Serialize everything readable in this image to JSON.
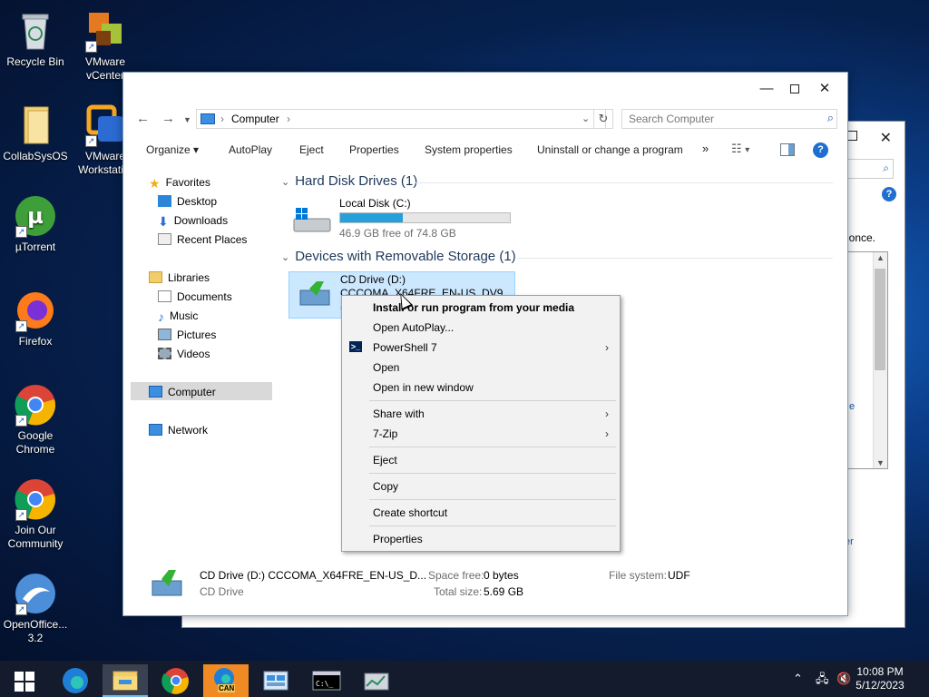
{
  "desktop": {
    "icons": [
      {
        "label": "Recycle Bin"
      },
      {
        "label": "VMware vCenter"
      },
      {
        "label": "CollabSysOS"
      },
      {
        "label": "VMware Workstati..."
      },
      {
        "label": "µTorrent"
      },
      {
        "label": "Firefox"
      },
      {
        "label": "Google Chrome"
      },
      {
        "label": "Join Our Community"
      },
      {
        "label": "OpenOffice... 3.2"
      }
    ]
  },
  "background_window": {
    "text": "once.",
    "link1": "e",
    "link2": "er"
  },
  "explorer": {
    "breadcrumb": "Computer",
    "search_placeholder": "Search Computer",
    "toolbar": {
      "organize": "Organize",
      "autoplay": "AutoPlay",
      "eject": "Eject",
      "properties": "Properties",
      "system_properties": "System properties",
      "uninstall": "Uninstall or change a program",
      "more": "»"
    },
    "nav": {
      "favorites": "Favorites",
      "desktop": "Desktop",
      "downloads": "Downloads",
      "recent_places": "Recent Places",
      "libraries": "Libraries",
      "documents": "Documents",
      "music": "Music",
      "pictures": "Pictures",
      "videos": "Videos",
      "computer": "Computer",
      "network": "Network"
    },
    "groups": {
      "hdd": "Hard Disk Drives (1)",
      "removable": "Devices with Removable Storage (1)"
    },
    "local_disk": {
      "name": "Local Disk (C:)",
      "free": "46.9 GB free of 74.8 GB",
      "used_fraction": 0.37
    },
    "cd_drive": {
      "name": "CD Drive (D:)",
      "label": "CCCOMA_X64FRE_EN-US_DV9",
      "extra": "("
    },
    "details": {
      "title": "CD Drive (D:) CCCOMA_X64FRE_EN-US_D...",
      "type": "CD Drive",
      "space_free_label": "Space free:",
      "space_free": "0 bytes",
      "total_size_label": "Total size:",
      "total_size": "5.69 GB",
      "fs_label": "File system:",
      "fs": "UDF"
    }
  },
  "context_menu": {
    "items": [
      {
        "label": "Install or run program from your media",
        "bold": true
      },
      {
        "label": "Open AutoPlay..."
      },
      {
        "label": "PowerShell 7",
        "submenu": true
      },
      {
        "label": "Open"
      },
      {
        "label": "Open in new window"
      },
      {
        "label": "Share with",
        "submenu": true
      },
      {
        "label": "7-Zip",
        "submenu": true
      },
      {
        "label": "Eject"
      },
      {
        "label": "Copy"
      },
      {
        "label": "Create shortcut"
      },
      {
        "label": "Properties"
      }
    ],
    "submenu_arrow": "›",
    "powershell_glyph": ">_"
  },
  "taskbar": {
    "time": "10:08 PM",
    "date": "5/12/2023",
    "chrome_badge": "CAN"
  }
}
